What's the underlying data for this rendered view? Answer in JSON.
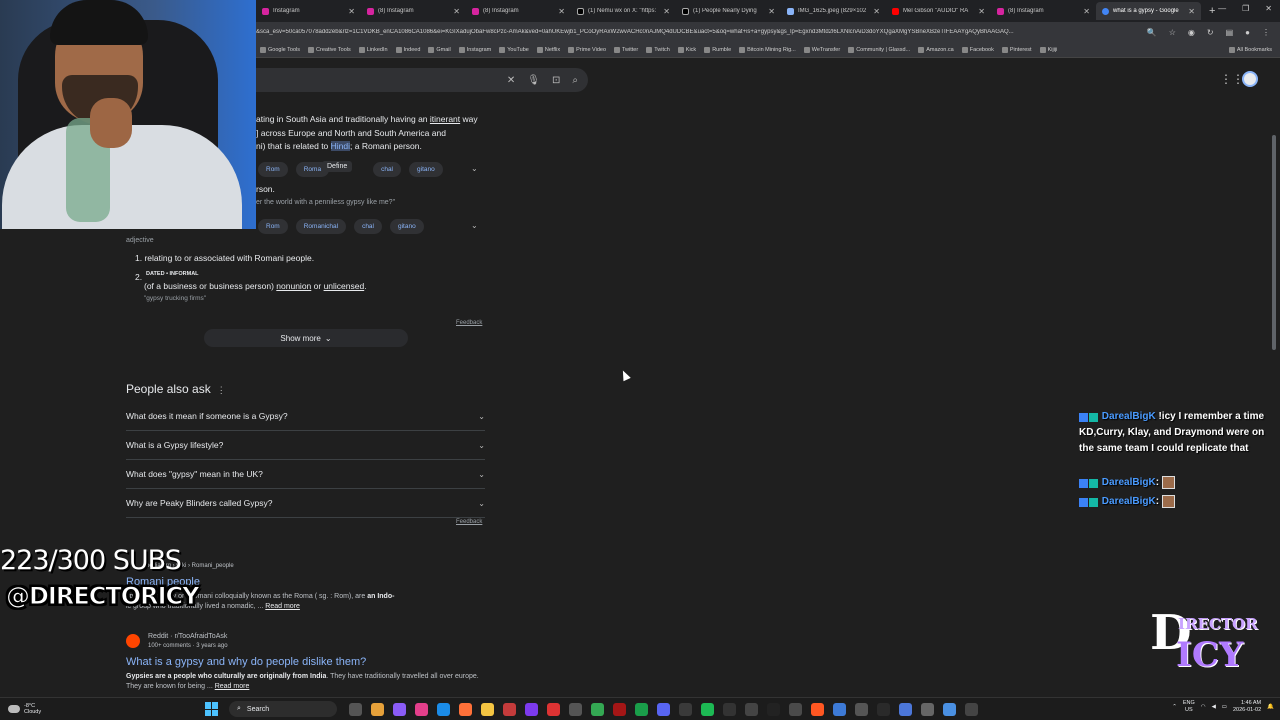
{
  "browser": {
    "tabs": [
      {
        "label": "Instagram",
        "icon": "instagram-icon"
      },
      {
        "label": "(8) Instagram",
        "icon": "instagram-icon"
      },
      {
        "label": "(8) Instagram",
        "icon": "instagram-icon"
      },
      {
        "label": "(1) Nemu wx on X: \"https:",
        "icon": "x-icon"
      },
      {
        "label": "(1) People Nearly Dying",
        "icon": "x-icon"
      },
      {
        "label": "IMG_1625.jpeg (829×102",
        "icon": "image-icon"
      },
      {
        "label": "Mel Gibson \"AUDIO\" RA",
        "icon": "youtube-icon"
      },
      {
        "label": "(8) Instagram",
        "icon": "instagram-icon"
      },
      {
        "label": "what is a gypsy - Google",
        "icon": "google-icon"
      }
    ],
    "url": "&sca_esv=50ca057078add2eb&rlz=1C1VDKB_enCA1086CA1086&ei=KGIXadujObaFw8cPzc-AmAk&ved=0ahUKEwjb1_PCoOyRAxW2wvACHc0nAJMQ4dUDCBE&uact=5&oq=what+is+a+gypsy&gs_lp=Egxnd3Mtd2l6LXNlcnAiD3doYXQgaXMgYSBneXBzeTIFEAAYgAQyBhAAGAQ...",
    "bookmarks": [
      "Google Tools",
      "Creative Tools",
      "LinkedIn",
      "Indeed",
      "Gmail",
      "Instagram",
      "YouTube",
      "Netflix",
      "Prime Video",
      "Twitter",
      "Twitch",
      "Kick",
      "Rumble",
      "Bitcoin Mining Rig...",
      "WeTransfer",
      "Community | Glassd...",
      "Amazon.ca",
      "Facebook",
      "Pinterest",
      "Kijiji"
    ],
    "all_bookmarks": "All Bookmarks"
  },
  "definition": {
    "line1_a": "ating in South Asia and traditionally having an ",
    "line1_link": "itinerant",
    "line1_b": " way",
    "line2": "] across Europe and North and South America and",
    "line3_a": "ni) that is related to ",
    "line3_hl": "Hindi",
    "line3_b": "; a Romani person.",
    "define_popup": "Define",
    "chips1": [
      "Rom",
      "Roma",
      "chal",
      "gitano"
    ],
    "person_fragment": "rson.",
    "example1": "er the world with a penniless gypsy like me?\"",
    "chips2": [
      "Rom",
      "Romanichal",
      "chal",
      "gitano"
    ],
    "pos": "adjective",
    "sense1": "1. relating to or associated with Romani people.",
    "sense2_num": "2.",
    "sense2_tag": "DATED • INFORMAL",
    "sense2_a": "(of a business or business person) ",
    "sense2_link1": "nonunion",
    "sense2_mid": " or ",
    "sense2_link2": "unlicensed",
    "sense2_end": ".",
    "example2": "\"gypsy trucking firms\"",
    "feedback": "Feedback",
    "show_more": "Show more"
  },
  "people_also_ask": {
    "title": "People also ask",
    "questions": [
      "What does it mean if someone is a Gypsy?",
      "What is a Gypsy lifestyle?",
      "What does \"gypsy\" mean in the UK?",
      "Why are Peaky Blinders called Gypsy?"
    ],
    "feedback": "Feedback"
  },
  "results": [
    {
      "url": "pedia.org › wiki › Romani_people",
      "title": "Romani people",
      "snippet_a": "spelled Romany or Rromani colloquially known as the Roma ( sg. : Rom), are ",
      "snippet_bold": "an Indo-",
      "snippet_b": "ic group who traditionally lived a nomadic, ... ",
      "read_more": "Read more"
    },
    {
      "source": "Reddit · r/TooAfraidToAsk",
      "meta": "100+ comments · 3 years ago",
      "title": "What is a gypsy and why do people dislike them?",
      "snippet_a": "Gypsies are a people who culturally are originally from India",
      "snippet_b": ". They have traditionally travelled all over europe. They are known for being ... ",
      "read_more": "Read more"
    }
  ],
  "overlay": {
    "subs": "223/300 SUBS",
    "handle": "@DIRECTORICY",
    "logo_big": "D",
    "logo_line1": "IRECTOR",
    "logo_line2": "ICY"
  },
  "chat": [
    {
      "user": "DarealBigK",
      "message": " !icy I remember a time KD,Curry, Klay, and Draymond were on the same team I could replicate that"
    },
    {
      "user": "DarealBigK",
      "message": " "
    },
    {
      "user": "DarealBigK",
      "message": " "
    }
  ],
  "taskbar": {
    "temp": "-8°C",
    "weather": "Cloudy",
    "search": "Search",
    "lang1": "ENG",
    "lang2": "US",
    "time": "1:46 AM",
    "date": "2026-01-02"
  },
  "colors": {
    "background": "#1f1f1f",
    "link": "#8ab4f8",
    "chat_user": "#4a9bff"
  }
}
